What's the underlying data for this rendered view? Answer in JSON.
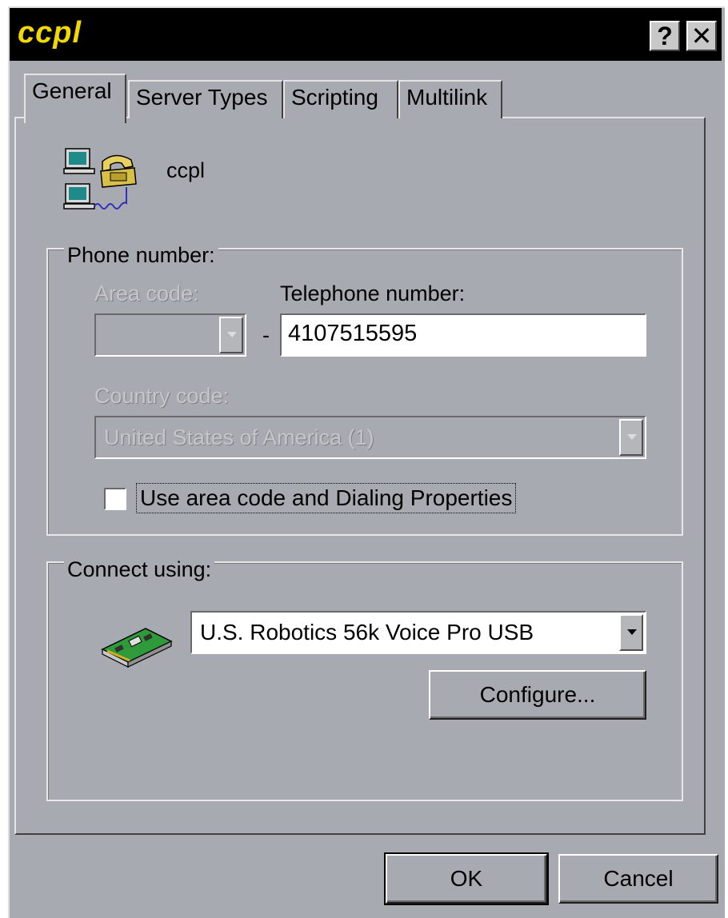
{
  "window": {
    "title": "ccpl",
    "help_button": "?",
    "close_button": "✕"
  },
  "tabs": [
    {
      "label": "General",
      "selected": true
    },
    {
      "label": "Server Types",
      "selected": false
    },
    {
      "label": "Scripting",
      "selected": false
    },
    {
      "label": "Multilink",
      "selected": false
    }
  ],
  "general": {
    "connection_name": "ccpl",
    "phone_group": {
      "legend": "Phone number:",
      "area_code_label": "Area code:",
      "area_code_value": "",
      "dash": "-",
      "telephone_label": "Telephone number:",
      "telephone_value": "4107515595",
      "country_code_label": "Country code:",
      "country_code_value": "United States of America (1)",
      "use_area_code_checkbox": {
        "label": "Use area code and Dialing Properties",
        "checked": false
      }
    },
    "connect_group": {
      "legend": "Connect using:",
      "device_value": "U.S. Robotics 56k Voice Pro USB",
      "configure_button": "Configure..."
    }
  },
  "footer": {
    "ok_button": "OK",
    "cancel_button": "Cancel"
  },
  "colors": {
    "title_bar_bg": "#000000",
    "title_text": "#f0d800",
    "dialog_face": "#a7aab0",
    "input_bg": "#ffffff"
  },
  "icons": {
    "connection": "dial-up-connection-icon",
    "modem": "modem-card-icon",
    "help": "help-icon",
    "close": "close-icon"
  }
}
